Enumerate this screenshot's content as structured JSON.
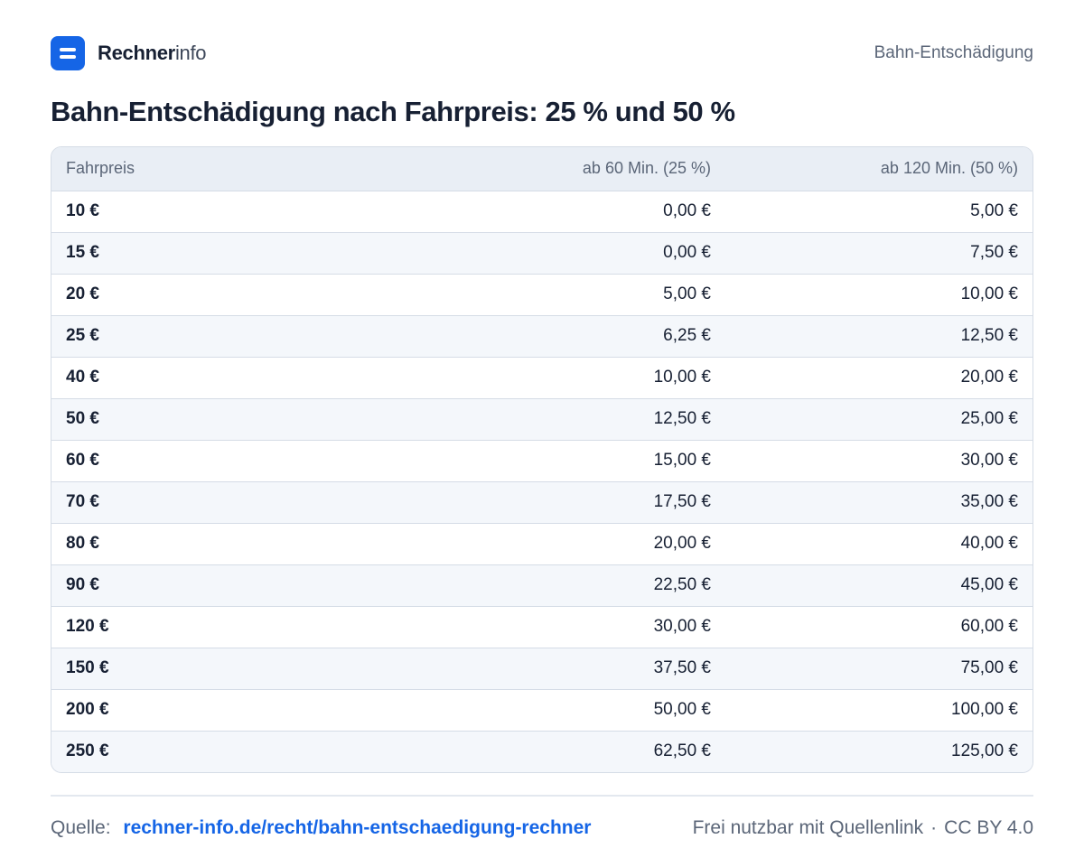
{
  "header": {
    "brand_bold": "Rechner",
    "brand_light": "info",
    "right_label": "Bahn-Entschädigung"
  },
  "title": "Bahn-Entschädigung nach Fahrpreis: 25 % und 50 %",
  "table": {
    "columns": [
      "Fahrpreis",
      "ab 60 Min. (25 %)",
      "ab 120 Min. (50 %)"
    ],
    "rows": [
      [
        "10 €",
        "0,00 €",
        "5,00 €"
      ],
      [
        "15 €",
        "0,00 €",
        "7,50 €"
      ],
      [
        "20 €",
        "5,00 €",
        "10,00 €"
      ],
      [
        "25 €",
        "6,25 €",
        "12,50 €"
      ],
      [
        "40 €",
        "10,00 €",
        "20,00 €"
      ],
      [
        "50 €",
        "12,50 €",
        "25,00 €"
      ],
      [
        "60 €",
        "15,00 €",
        "30,00 €"
      ],
      [
        "70 €",
        "17,50 €",
        "35,00 €"
      ],
      [
        "80 €",
        "20,00 €",
        "40,00 €"
      ],
      [
        "90 €",
        "22,50 €",
        "45,00 €"
      ],
      [
        "120 €",
        "30,00 €",
        "60,00 €"
      ],
      [
        "150 €",
        "37,50 €",
        "75,00 €"
      ],
      [
        "200 €",
        "50,00 €",
        "100,00 €"
      ],
      [
        "250 €",
        "62,50 €",
        "125,00 €"
      ]
    ]
  },
  "footer": {
    "source_label": "Quelle:",
    "source_link": "rechner-info.de/recht/bahn-entschaedigung-rechner",
    "license_text": "Frei nutzbar mit Quellenlink",
    "separator": "·",
    "license_name": "CC BY 4.0"
  },
  "colors": {
    "accent": "#1565e6",
    "text": "#172033",
    "muted": "#5b6678",
    "header_bg": "#e9eef5",
    "stripe_bg": "#f4f7fb",
    "border": "#d5dce6"
  },
  "icons": {
    "logo": "rechner-logo-icon"
  }
}
